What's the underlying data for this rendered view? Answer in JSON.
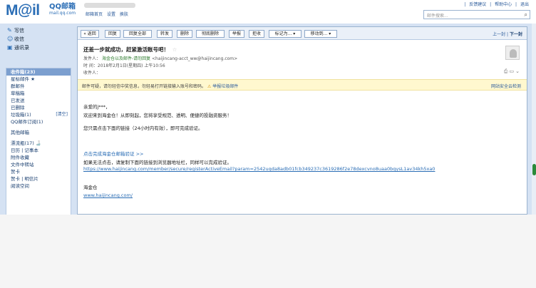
{
  "app": {
    "logo_text": "M@il",
    "logo_cn": "QQ邮箱",
    "logo_url": "mail.qq.com",
    "user_links": [
      "邮箱首页",
      "设置",
      "换肤"
    ],
    "top_links": [
      "|",
      "反馈建议",
      "|",
      "帮助中心",
      "|",
      "退出"
    ],
    "search_placeholder": "邮件搜索..."
  },
  "left": {
    "quick": [
      "写信",
      "收信",
      "通讯录"
    ],
    "folders": [
      {
        "label": "收件箱(23)",
        "selected": true
      },
      {
        "label": "星标邮件 ★"
      },
      {
        "label": "群邮件"
      },
      {
        "label": "草稿箱"
      },
      {
        "label": "已发送"
      },
      {
        "label": "已删除"
      },
      {
        "label": "垃圾箱(1)",
        "action": "[清空]"
      },
      {
        "label": "QQ邮件订阅(1)"
      },
      {
        "label": "其他邮箱",
        "gap": true
      },
      {
        "label": "漂流瓶(17) 🍶",
        "gap": true
      },
      {
        "label": "日历 | 记事本"
      },
      {
        "label": "附件收藏"
      },
      {
        "label": "文件中转站"
      },
      {
        "label": "贺卡"
      },
      {
        "label": "贺卡 | 明信片"
      },
      {
        "label": "阅读空间"
      }
    ]
  },
  "toolbar": {
    "buttons": [
      "« 返回",
      "回复",
      "回复全部",
      "转发",
      "删除",
      "彻底删除",
      "举报",
      "拒收",
      "标记为... ▾",
      "移动到... ▾"
    ],
    "prev": "上一封",
    "next": "下一封"
  },
  "mail": {
    "subject": "还差一步就成功，赶紧激活账号吧！",
    "from_label": "发件人：",
    "sender_name": "海金仓以及邮件-请勿回复",
    "sender_addr": "<haijincang-acct_ww@haijincang.com>",
    "time_label": "时 间：2018年2月1日(星期四) 上午10:56",
    "to_label": "收件人：",
    "warning": "邮件可疑，请勿轻信中奖信息，勿轻易打开链接输入账号和密码。",
    "report_link": "举报垃圾邮件",
    "safety_link": "网站安全云检测",
    "greeting": "亲爱的j***，",
    "welcome": "欢迎来到海金仓！从即刻起，您将享受规范、透明、便捷的投融资服务！",
    "instruction": "您只需点击下面的链接（24小时内有效），即可完成验证。",
    "verify_link": "点击完成海金仓邮箱验证 >>",
    "copy_hint": "如果无法点击，请复制下面的链接到浏览器地址栏，同样可以完成验证。",
    "long_url": "https://www.haijincang.com/member/secure/registerActiveEmail?param=2542uqda8adb01fcb349237c3619286f2e78dexcvno8uaa0bqysL1av34kh5xa0",
    "signature": "海金仓",
    "site_url": "www.haijincang.com/"
  }
}
